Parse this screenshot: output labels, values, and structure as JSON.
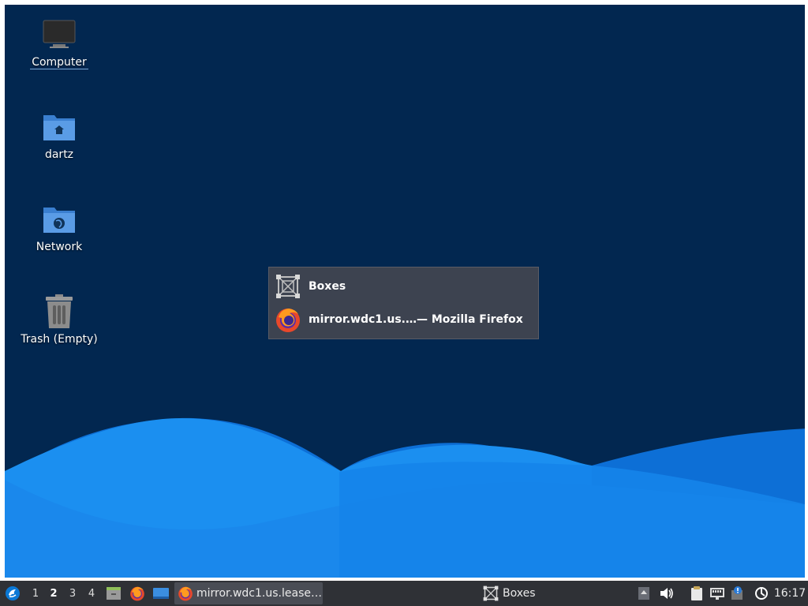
{
  "desktop": {
    "icons": [
      {
        "label": "Computer",
        "icon": "computer-icon"
      },
      {
        "label": "dartz",
        "icon": "home-folder-icon"
      },
      {
        "label": "Network",
        "icon": "network-folder-icon"
      },
      {
        "label": "Trash (Empty)",
        "icon": "trash-icon"
      }
    ]
  },
  "switcher": {
    "items": [
      {
        "label": "Boxes",
        "icon": "boxes-icon"
      },
      {
        "label": "mirror.wdc1.us.…— Mozilla Firefox",
        "icon": "firefox-icon"
      }
    ]
  },
  "taskbar": {
    "workspaces": [
      "1",
      "2",
      "3",
      "4"
    ],
    "active_workspace": "2",
    "tasks": [
      {
        "label": "mirror.wdc1.us.lease…",
        "icon": "firefox-icon"
      },
      {
        "label": "Boxes",
        "icon": "boxes-icon"
      }
    ],
    "clock": "16:17"
  },
  "colors": {
    "desktop_bg": "#022750",
    "wave_light": "#1e90f0",
    "wave_dark": "#0f6fd8",
    "taskbar_bg": "#2f3136"
  }
}
